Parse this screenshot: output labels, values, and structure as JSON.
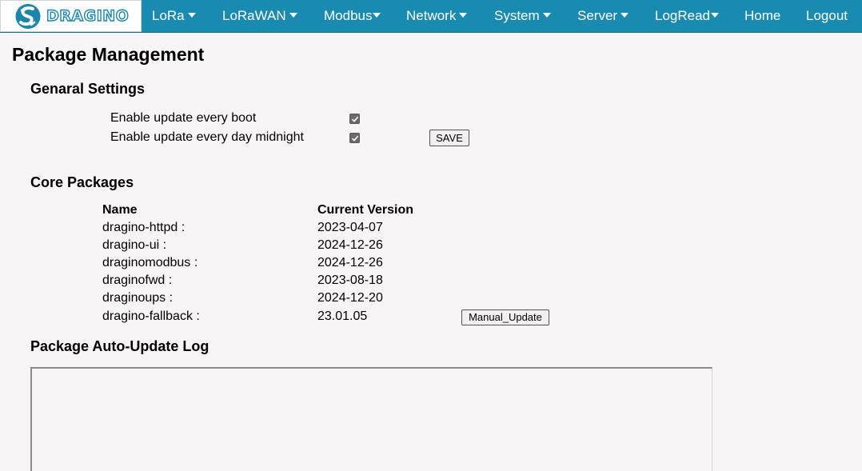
{
  "brand": {
    "logo_text": "DRAGINO",
    "accent_color": "#1a8bb0"
  },
  "nav": {
    "items": [
      {
        "label": "LoRa",
        "dropdown": true
      },
      {
        "label": "LoRaWAN",
        "dropdown": true
      },
      {
        "label": "Modbus",
        "dropdown": true
      },
      {
        "label": "Network",
        "dropdown": true
      },
      {
        "label": "System",
        "dropdown": true
      },
      {
        "label": "Server",
        "dropdown": true
      },
      {
        "label": "LogRead",
        "dropdown": true
      },
      {
        "label": "Home",
        "dropdown": false
      },
      {
        "label": "Logout",
        "dropdown": false
      }
    ]
  },
  "page": {
    "title": "Package Management"
  },
  "general": {
    "title": "Genaral Settings",
    "boot_label": "Enable update every boot",
    "boot_checked": true,
    "midnight_label": "Enable update every day midnight",
    "midnight_checked": true,
    "save_label": "SAVE"
  },
  "core": {
    "title": "Core Packages",
    "col_name": "Name",
    "col_version": "Current Version",
    "packages": [
      {
        "name": "dragino-httpd :",
        "version": "2023-04-07"
      },
      {
        "name": "dragino-ui :",
        "version": "2024-12-26"
      },
      {
        "name": "draginomodbus :",
        "version": "2024-12-26"
      },
      {
        "name": "draginofwd :",
        "version": "2023-08-18"
      },
      {
        "name": "draginoups :",
        "version": "2024-12-20"
      },
      {
        "name": "dragino-fallback :",
        "version": "23.01.05"
      }
    ],
    "manual_update_label": "Manual_Update"
  },
  "log": {
    "title": "Package Auto-Update Log",
    "content": ""
  }
}
